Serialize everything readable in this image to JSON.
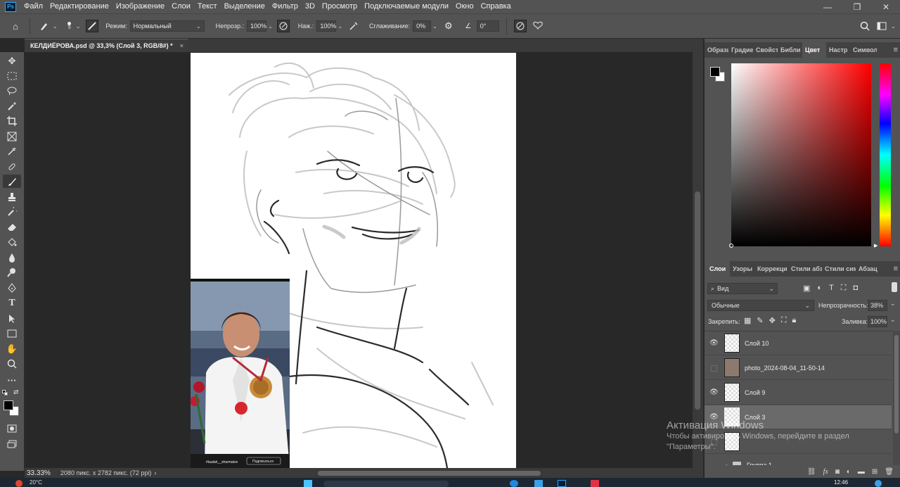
{
  "menubar": {
    "items": [
      "Файл",
      "Редактирование",
      "Изображение",
      "Слои",
      "Текст",
      "Выделение",
      "Фильтр",
      "3D",
      "Просмотр",
      "Подключаемые модули",
      "Окно",
      "Справка"
    ]
  },
  "options": {
    "brush_size": "9",
    "mode_label": "Режим:",
    "mode_value": "Нормальный",
    "opacity_label": "Непрозр.:",
    "opacity_value": "100%",
    "pressure_label": "Наж.:",
    "pressure_value": "100%",
    "smoothing_label": "Сглаживание:",
    "smoothing_value": "0%",
    "angle_value": "0°"
  },
  "document": {
    "tab_title": "КЕЛДИЁРОВА.psd @ 33,3% (Слой 3, RGB/8#) *",
    "tab_close": "×",
    "zoom": "33.33%",
    "doc_info": "2080 пикс. x 2782 пикс. (72 ppi)"
  },
  "color_panel": {
    "tabs": [
      "Образц",
      "Градие",
      "Свойст",
      "Библи",
      "Цвет",
      "Настр",
      "Символ"
    ],
    "active_tab": "Цвет",
    "foreground": "#000000",
    "background": "#ffffff"
  },
  "layers_panel": {
    "tabs": [
      "Слои",
      "Узоры",
      "Коррекци",
      "Стили абз",
      "Стили сим",
      "Абзац"
    ],
    "filter_value": "Вид",
    "blend_mode": "Обычные",
    "opacity_label": "Непрозрачность:",
    "opacity_value": "38%",
    "lock_label": "Закрепить:",
    "fill_label": "Заливка:",
    "fill_value": "100%",
    "layers": [
      {
        "name": "Слой 10",
        "visible": true,
        "selected": false
      },
      {
        "name": "photo_2024-08-04_11-50-14",
        "visible": false,
        "selected": false
      },
      {
        "name": "Слой 9",
        "visible": true,
        "selected": false
      },
      {
        "name": "Слой 3",
        "visible": true,
        "selected": true
      },
      {
        "name": "",
        "visible": false,
        "selected": false
      },
      {
        "name": "Группа 1",
        "visible": false,
        "selected": false
      }
    ]
  },
  "photo": {
    "caption_user": "#taalah__sharmatov",
    "caption_button": "Подписаться"
  },
  "activation": {
    "line1": "Активация Windows",
    "line2": "Чтобы активировать Windows, перейдите в раздел",
    "line3": "\"Параметры\"."
  },
  "taskbar": {
    "temp": "20°C",
    "time": "12:46"
  }
}
